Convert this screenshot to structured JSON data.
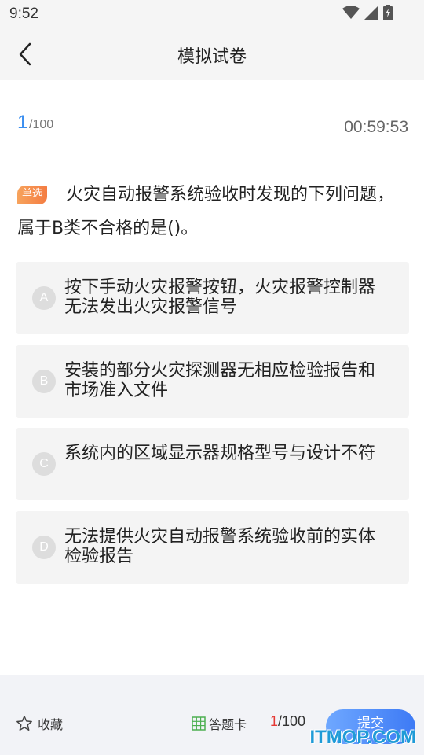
{
  "status_bar": {
    "time": "9:52"
  },
  "navbar": {
    "title": "模拟试卷"
  },
  "progress": {
    "current": "1",
    "total": "/100",
    "timer": "00:59:53"
  },
  "question": {
    "type_badge": "单选",
    "text": "火灾自动报警系统验收时发现的下列问题，属于B类不合格的是()。"
  },
  "options": [
    {
      "letter": "A",
      "text": "按下手动火灾报警按钮，火灾报警控制器无法发出火灾报警信号"
    },
    {
      "letter": "B",
      "text": "安装的部分火灾探测器无相应检验报告和市场准入文件"
    },
    {
      "letter": "C",
      "text": "系统内的区域显示器规格型号与设计不符"
    },
    {
      "letter": "D",
      "text": "无法提供火灾自动报警系统验收前的实体检验报告"
    }
  ],
  "bottom_bar": {
    "favorite_label": "收藏",
    "answer_card_label": "答题卡",
    "count_current": "1",
    "count_total": "/100",
    "submit_label": "提交"
  },
  "watermark": "ITMOP.COM",
  "colors": {
    "accent_blue": "#3b8ff0",
    "badge_orange": "#f47c42",
    "count_red": "#e53935",
    "submit_blue": "#3d7af5"
  }
}
